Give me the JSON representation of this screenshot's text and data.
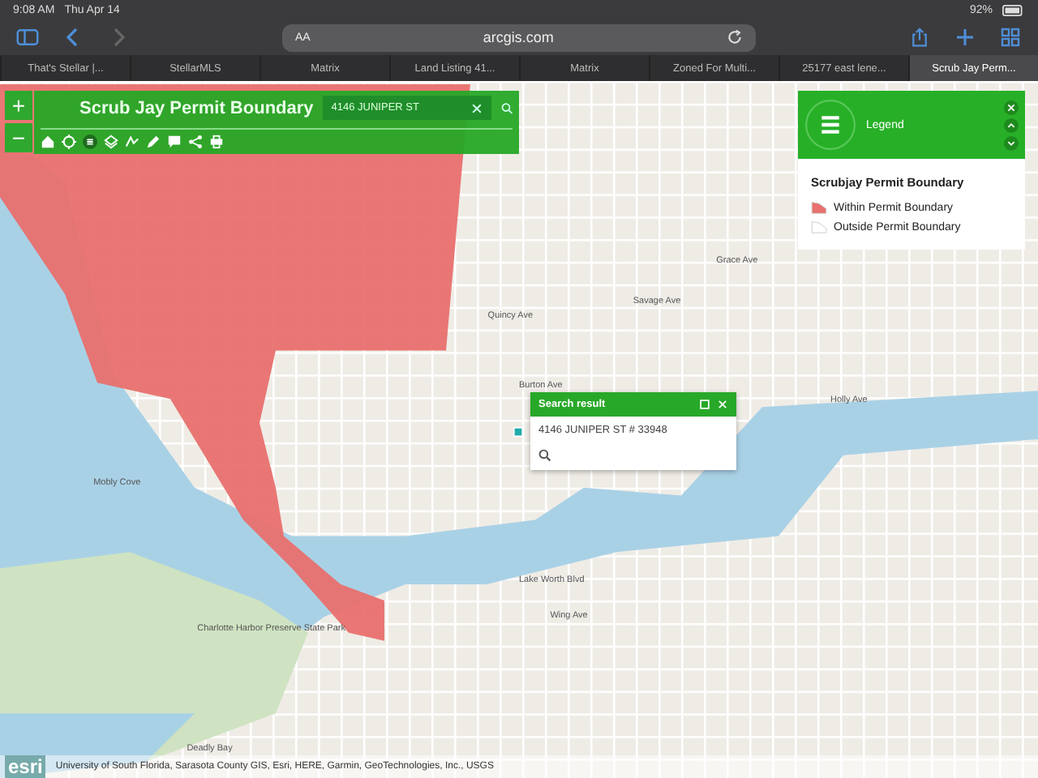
{
  "status_bar": {
    "time": "9:08 AM",
    "date": "Thu Apr 14",
    "battery": "92%"
  },
  "browser": {
    "text_size": "AA",
    "address": "arcgis.com"
  },
  "tabs": [
    {
      "label": "That's Stellar |...",
      "selected": false
    },
    {
      "label": "StellarMLS",
      "selected": false
    },
    {
      "label": "Matrix",
      "selected": false
    },
    {
      "label": "Land Listing 41...",
      "selected": false
    },
    {
      "label": "Matrix",
      "selected": false
    },
    {
      "label": "Zoned For Multi...",
      "selected": false
    },
    {
      "label": "25177 east lene...",
      "selected": false
    },
    {
      "label": "Scrub Jay Perm...",
      "selected": true
    }
  ],
  "map": {
    "zoom_in": "+",
    "zoom_out": "−",
    "title": "Scrub Jay Permit Boundary",
    "search": {
      "value": "4146 JUNIPER ST"
    },
    "labels": [
      "Quincy Ave",
      "Burton Ave",
      "Grace Ave",
      "Savage Ave",
      "Holly Ave",
      "Lake Worth Blvd",
      "Wing Ave",
      "Mobly Cove",
      "Charlotte Harbor Preserve State Park",
      "Deadly Bay"
    ],
    "legend": {
      "title": "Legend",
      "layer": "Scrubjay Permit Boundary",
      "items": [
        {
          "label": "Within Permit Boundary",
          "color": "#e8706e"
        },
        {
          "label": "Outside Permit Boundary",
          "color": "#ffffff"
        }
      ]
    },
    "popup": {
      "title": "Search result",
      "result": "4146 JUNIPER ST # 33948"
    },
    "attribution": {
      "logo": "esri",
      "text": "University of South Florida, Sarasota County GIS, Esri, HERE, Garmin, GeoTechnologies, Inc., USGS"
    }
  }
}
